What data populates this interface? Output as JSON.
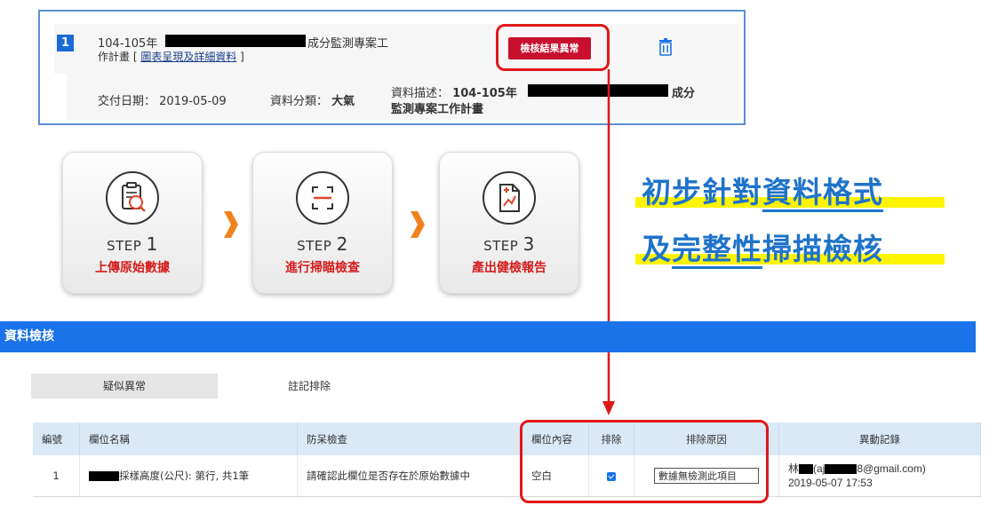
{
  "record": {
    "index": "1",
    "title_line1_pre": "104-105年",
    "title_line1_post": "成分監測專案工",
    "title_line2_pre": "作計畫 [",
    "title_link": "圖表呈現及詳細資料",
    "title_line2_post": "]",
    "status_button": "檢核結果異常",
    "delivery_label": "交付日期：",
    "delivery_value": "2019-05-09",
    "category_label": "資料分類：",
    "category_value": "大氣",
    "desc_label": "資料描述：",
    "desc_pre": "104-105年",
    "desc_post": "成分",
    "desc_line2": "監測專案工作計畫"
  },
  "steps": [
    {
      "word": "STEP",
      "num": "1",
      "label": "上傳原始數據",
      "icon": "clipboard-search-icon"
    },
    {
      "word": "STEP",
      "num": "2",
      "label": "進行掃瞄檢查",
      "icon": "scan-icon"
    },
    {
      "word": "STEP",
      "num": "3",
      "label": "產出健檢報告",
      "icon": "report-chart-icon"
    }
  ],
  "headline": {
    "line1_a": "初步針對",
    "line1_b": "資料格式",
    "line2_a": "及",
    "line2_b": "完整性",
    "line2_c": "掃描檢核"
  },
  "panel": {
    "title": "資料檢核",
    "tab_suspect": "疑似異常",
    "tab_excluded": "註記排除",
    "columns": [
      "編號",
      "欄位名稱",
      "防呆檢查",
      "欄位內容",
      "排除",
      "排除原因",
      "異動記錄"
    ],
    "row": {
      "no": "1",
      "field_name": "採樣高度(公尺): 第行, 共1筆",
      "check": "請確認此欄位是否存在於原始數據中",
      "content": "空白",
      "excluded": true,
      "reason": "數據無檢測此項目",
      "log_user_pre": "林",
      "log_user_mid": "(aj",
      "log_user_post": "8@gmail.com)",
      "log_time": "2019-05-07 17:53"
    }
  },
  "colors": {
    "accent_blue": "#1a73e8",
    "alert_red": "#c8102e",
    "highlight_yellow": "#fff400",
    "headline_blue": "#1f73c9",
    "step_orange": "#f0821e"
  }
}
